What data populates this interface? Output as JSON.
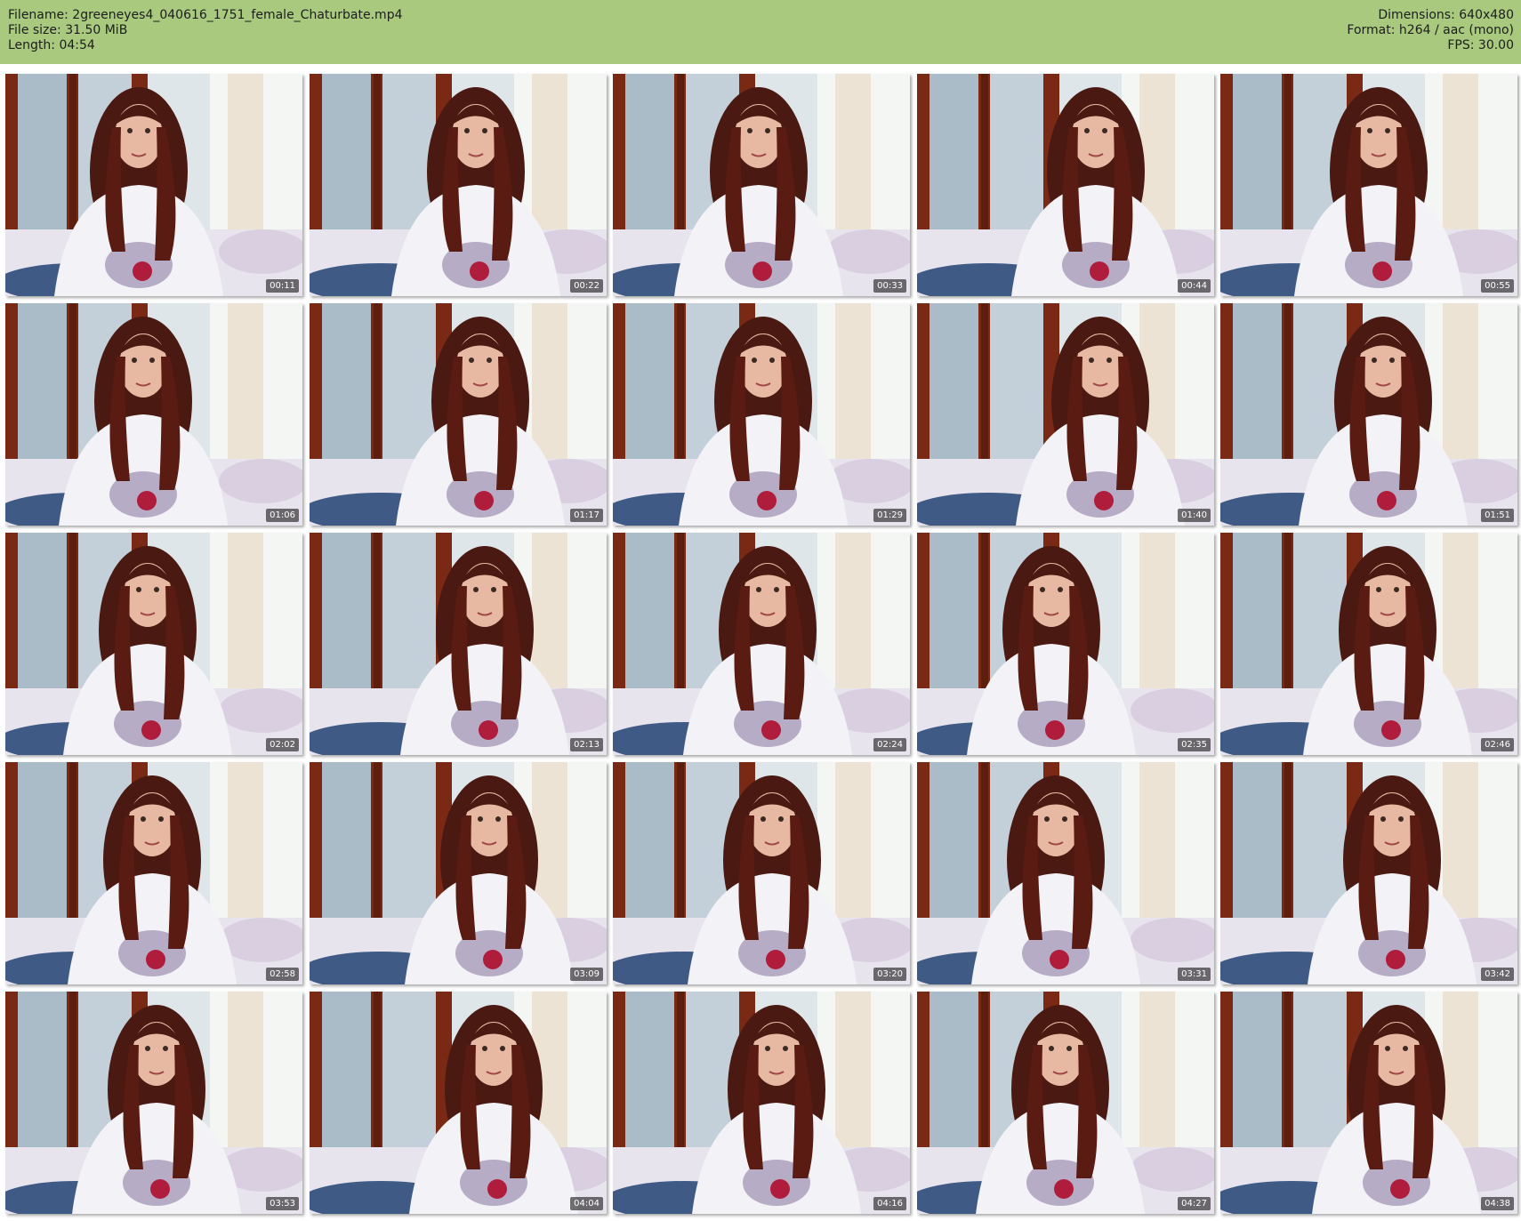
{
  "header": {
    "left_lines": [
      "Filename: 2greeneyes4_040616_1751_female_Chaturbate.mp4",
      "File size: 31.50 MiB",
      "Length: 04:54"
    ],
    "right_lines": [
      "Dimensions: 640x480",
      "Format: h264 / aac (mono)",
      "FPS: 30.00"
    ],
    "background_color": "#a9c97f"
  },
  "thumbnails": [
    {
      "timestamp": "00:11"
    },
    {
      "timestamp": "00:22"
    },
    {
      "timestamp": "00:33"
    },
    {
      "timestamp": "00:44"
    },
    {
      "timestamp": "00:55"
    },
    {
      "timestamp": "01:06"
    },
    {
      "timestamp": "01:17"
    },
    {
      "timestamp": "01:29"
    },
    {
      "timestamp": "01:40"
    },
    {
      "timestamp": "01:51"
    },
    {
      "timestamp": "02:02"
    },
    {
      "timestamp": "02:13"
    },
    {
      "timestamp": "02:24"
    },
    {
      "timestamp": "02:35"
    },
    {
      "timestamp": "02:46"
    },
    {
      "timestamp": "02:58"
    },
    {
      "timestamp": "03:09"
    },
    {
      "timestamp": "03:20"
    },
    {
      "timestamp": "03:31"
    },
    {
      "timestamp": "03:42"
    },
    {
      "timestamp": "03:53"
    },
    {
      "timestamp": "04:04"
    },
    {
      "timestamp": "04:16"
    },
    {
      "timestamp": "04:27"
    },
    {
      "timestamp": "04:38"
    }
  ]
}
